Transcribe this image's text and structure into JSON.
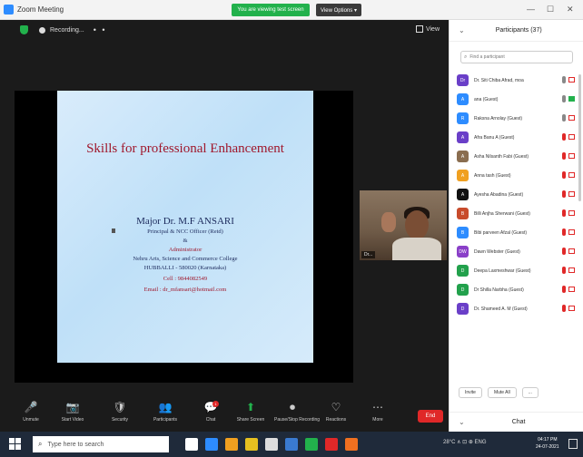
{
  "window": {
    "title": "Zoom Meeting",
    "share_banner": "You are viewing test screen",
    "view_options": "View Options ▾",
    "controls": [
      "—",
      "☐",
      "✕"
    ]
  },
  "meeting": {
    "recording_label": "Recording...",
    "top_dots": "• •",
    "gallery_label": "View"
  },
  "slide": {
    "title": "Skills for professional Enhancement",
    "name": "Major Dr. M.F ANSARI",
    "lines": [
      {
        "text": "Principal & NCC Officer (Retd)",
        "red": false
      },
      {
        "text": "&",
        "red": false
      },
      {
        "text": "Administrator",
        "red": true
      },
      {
        "text": "Nehru Arts, Science and Commerce College",
        "red": false
      },
      {
        "text": "HUBBALLI - 580020 (Karnataka)",
        "red": false
      },
      {
        "text": "Cell : 9844082549",
        "red": true
      },
      {
        "text": "Email : dr_mfansari@hotmail.com",
        "red": true
      }
    ]
  },
  "thumbnail": {
    "label": "Dr..."
  },
  "toolbar": {
    "buttons": [
      {
        "icon": "🎤",
        "label": "Unmute"
      },
      {
        "icon": "📷",
        "label": "Start Video"
      },
      {
        "icon": "🛡",
        "label": "Security"
      },
      {
        "icon": "👥",
        "label": "Participants"
      },
      {
        "icon": "💬",
        "label": "Chat"
      },
      {
        "icon": "⬆",
        "label": "Share Screen"
      },
      {
        "icon": "⏺",
        "label": "Pause/Stop Recording"
      },
      {
        "icon": "♡",
        "label": "Reactions"
      },
      {
        "icon": "⋯",
        "label": "More"
      }
    ],
    "chat_badge": "1",
    "end_label": "End"
  },
  "participants": {
    "header": "Participants (37)",
    "search_placeholder": "Find a participant",
    "items": [
      {
        "initials": "Dr",
        "color": "#6a3fc8",
        "name": "Dr. Siti Chiba Afrad, moa",
        "mic_on": true,
        "cam_on": false
      },
      {
        "initials": "A",
        "color": "#2d8cff",
        "name": "ana (Guest)",
        "mic_on": true,
        "cam_on": true
      },
      {
        "initials": "R",
        "color": "#2d8cff",
        "name": "Raksna Arnolay (Guest)",
        "mic_on": true,
        "cam_on": false
      },
      {
        "initials": "A",
        "color": "#6a3fc8",
        "name": "Afra Banu A (Guest)",
        "mic_on": false,
        "cam_on": false
      },
      {
        "initials": "A",
        "color": "#8a6d4f",
        "name": "Asha Nilsanth Fabi (Guest)",
        "mic_on": false,
        "cam_on": false
      },
      {
        "initials": "A",
        "color": "#f0a020",
        "name": "Anna tash (Guest)",
        "mic_on": false,
        "cam_on": false
      },
      {
        "initials": "A",
        "color": "#111111",
        "name": "Ayesha Abadina (Guest)",
        "mic_on": false,
        "cam_on": false
      },
      {
        "initials": "B",
        "color": "#c84b2b",
        "name": "Billi Anjha Sherwani (Guest)",
        "mic_on": false,
        "cam_on": false
      },
      {
        "initials": "B",
        "color": "#2d8cff",
        "name": "Bibi parveen Afzal (Guest)",
        "mic_on": false,
        "cam_on": false
      },
      {
        "initials": "DW",
        "color": "#8a3fc8",
        "name": "Dawn Webster (Guest)",
        "mic_on": false,
        "cam_on": false
      },
      {
        "initials": "D",
        "color": "#22a14c",
        "name": "Deepa Laxmeshwar (Guest)",
        "mic_on": false,
        "cam_on": false
      },
      {
        "initials": "D",
        "color": "#22a14c",
        "name": "Dr Shilla Narbha (Guest)",
        "mic_on": false,
        "cam_on": false
      },
      {
        "initials": "D",
        "color": "#6a3fc8",
        "name": "Dr. Shameed A. M (Guest)",
        "mic_on": false,
        "cam_on": false
      }
    ],
    "buttons": [
      "Invite",
      "Mute All",
      "..."
    ],
    "chat_label": "Chat"
  },
  "taskbar": {
    "search_placeholder": "Type here to search",
    "tray_text": "28°C  ∧  ⊡  ⊕  ENG",
    "time": "04:17 PM",
    "date": "24-07-2021",
    "app_colors": [
      "#ffffff",
      "#2d8cff",
      "#f0a020",
      "#e6c020",
      "#dddddd",
      "#3a7ad0",
      "#22b14c",
      "#e02828",
      "#f07020"
    ]
  }
}
